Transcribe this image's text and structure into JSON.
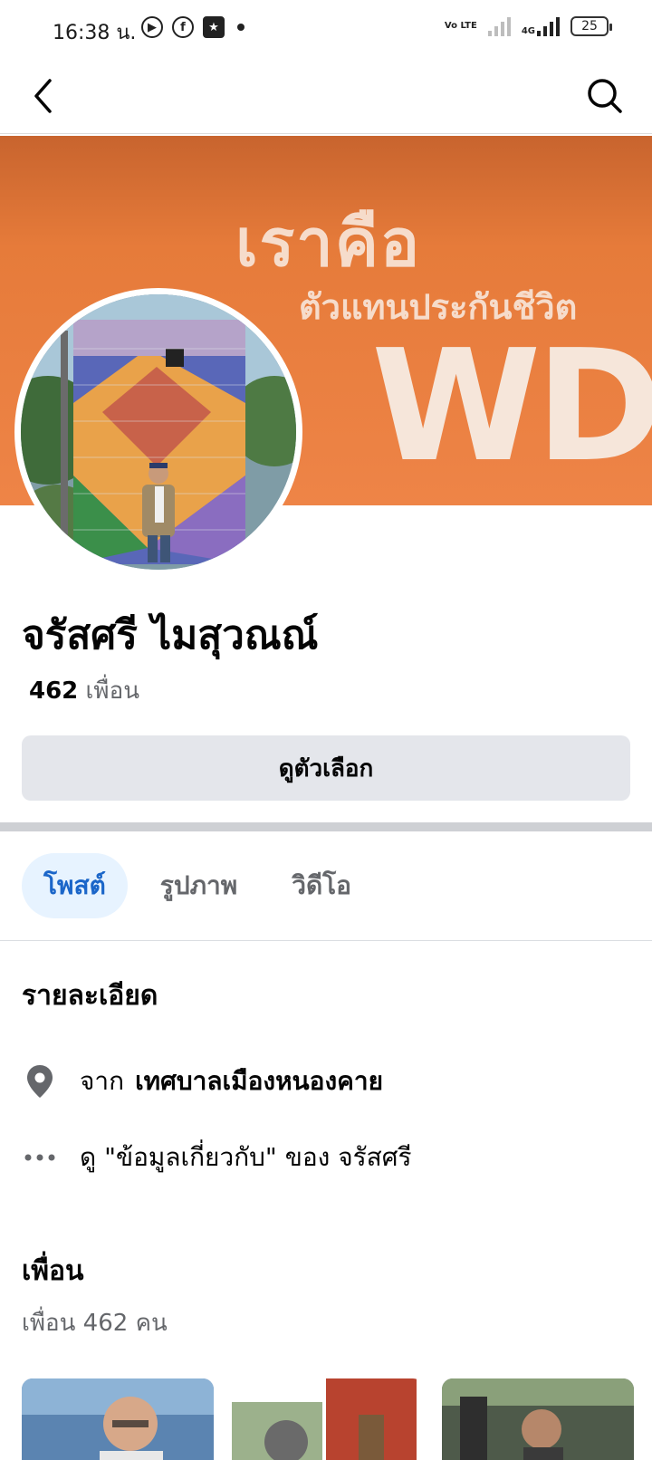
{
  "status_bar": {
    "time": "16:38 น.",
    "battery": "25",
    "volte": "Vo LTE",
    "network": "4G"
  },
  "nav": {
    "back_icon": "chevron-left-icon",
    "search_icon": "search-icon"
  },
  "cover": {
    "line1": "เราคือ",
    "line2": "ตัวแทนประกันชีวิต",
    "line3": "WD"
  },
  "profile": {
    "name": "จรัสศรี ไมสุวณณ์",
    "friends_count": "462",
    "friends_label": "เพื่อน"
  },
  "options_button": "ดูตัวเลือก",
  "tabs": [
    {
      "label": "โพสต์"
    },
    {
      "label": "รูปภาพ"
    },
    {
      "label": "วิดีโอ"
    }
  ],
  "details": {
    "title": "รายละเอียด",
    "from_prefix": "จาก",
    "from_place": "เทศบาลเมืองหนองคาย",
    "about_text": "ดู \"ข้อมูลเกี่ยวกับ\" ของ จรัสศรี"
  },
  "friends_section": {
    "title": "เพื่อน",
    "count_text": "เพื่อน 462 คน"
  },
  "colors": {
    "accent": "#1b66c9",
    "cover": "#e67b3a"
  }
}
